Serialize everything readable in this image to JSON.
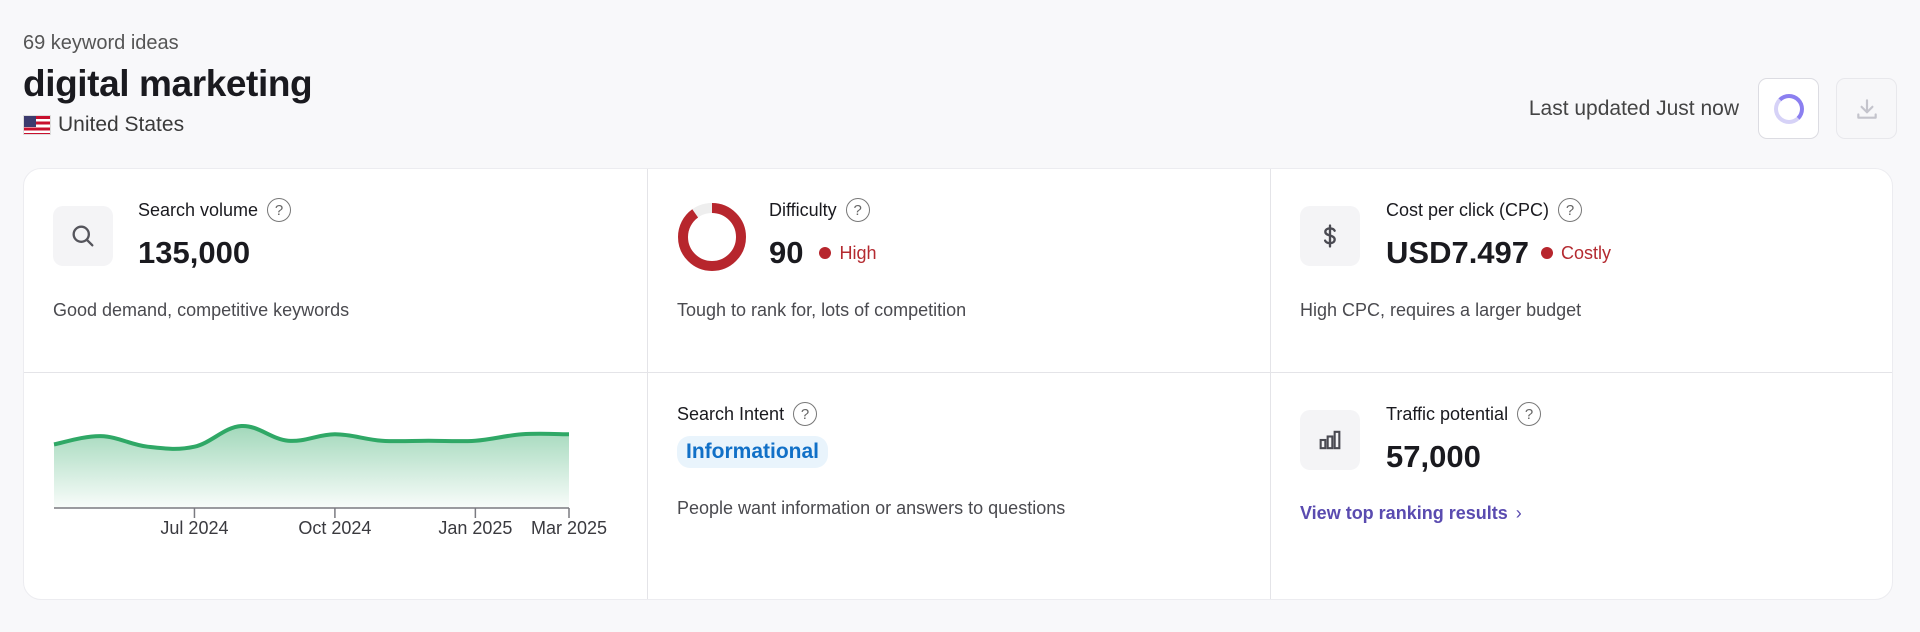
{
  "header": {
    "keyword_count": "69 keyword ideas",
    "keyword": "digital marketing",
    "country": "United States"
  },
  "toolbar": {
    "last_updated": "Last updated Just now"
  },
  "metrics": {
    "search_volume": {
      "title": "Search volume",
      "value": "135,000",
      "description": "Good demand, competitive keywords"
    },
    "difficulty": {
      "title": "Difficulty",
      "value": "90",
      "level": "High",
      "description": "Tough to rank for, lots of competition",
      "fraction": 0.9
    },
    "cpc": {
      "title": "Cost per click (CPC)",
      "value": "USD7.497",
      "level": "Costly",
      "description": "High CPC, requires a larger budget"
    },
    "search_intent": {
      "title": "Search Intent",
      "badge": "Informational",
      "description": "People want information or answers to questions"
    },
    "traffic_potential": {
      "title": "Traffic potential",
      "value": "57,000",
      "link": "View top ranking results"
    }
  },
  "colors": {
    "accent_green": "#2fa866",
    "danger_red": "#b7262d",
    "intent_blue": "#1170c7",
    "link_purple": "#5a4bb0"
  },
  "chart_data": {
    "type": "area",
    "x_ticks": [
      "Jul 2024",
      "Oct 2024",
      "Jan 2025",
      "Mar 2025"
    ],
    "x": [
      0,
      1,
      2,
      3,
      4,
      5,
      6,
      7,
      8,
      9,
      10,
      11
    ],
    "x_tick_positions": [
      3,
      6,
      9,
      11
    ],
    "values": [
      0.6,
      0.78,
      0.55,
      0.55,
      1.0,
      0.68,
      0.82,
      0.68,
      0.68,
      0.68,
      0.82,
      0.82
    ],
    "grid": false
  }
}
